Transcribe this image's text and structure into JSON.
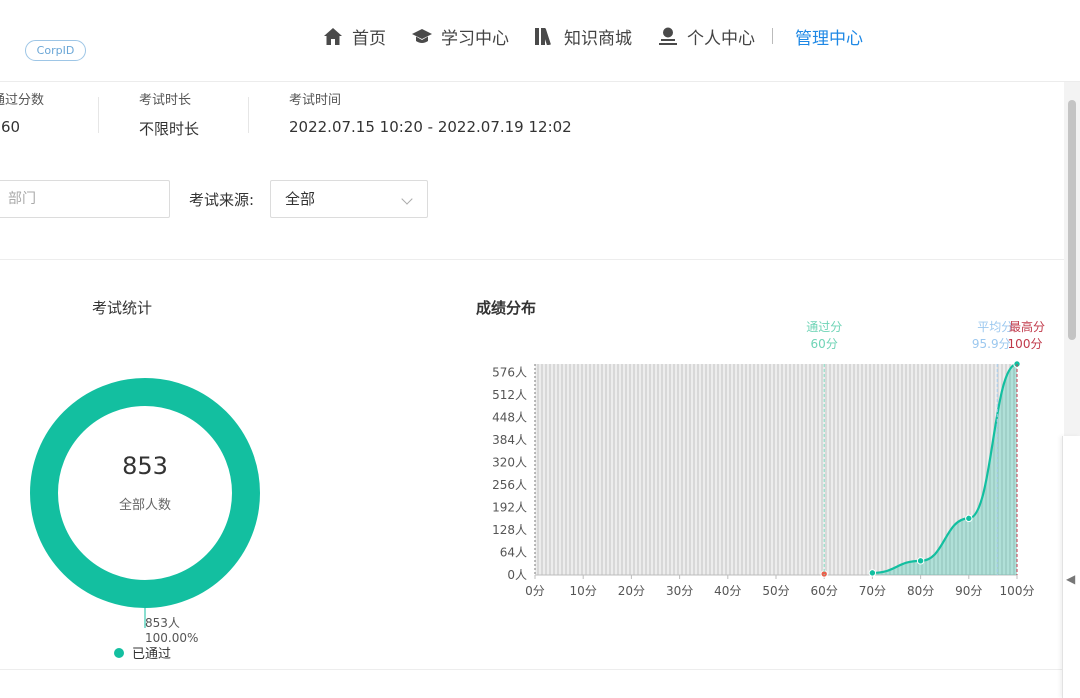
{
  "logo": "CorpID",
  "nav": {
    "items": [
      {
        "label": "首页",
        "icon": "home-icon"
      },
      {
        "label": "学习中心",
        "icon": "graduation-cap-icon"
      },
      {
        "label": "知识商城",
        "icon": "books-icon"
      },
      {
        "label": "个人中心",
        "icon": "user-icon"
      }
    ],
    "active": "管理中心"
  },
  "info": {
    "pass_label": "通过分数",
    "pass_value": "60",
    "duration_label": "考试时长",
    "duration_value": "不限时长",
    "time_label": "考试时间",
    "time_value": "2022.07.15 10:20 - 2022.07.19 12:02"
  },
  "filters": {
    "dept_placeholder": "部门",
    "source_label": "考试来源:",
    "source_value": "全部"
  },
  "stats": {
    "title": "考试统计",
    "total": "853",
    "total_label": "全部人数",
    "passed_count": "853人",
    "passed_pct": "100.00%",
    "legend_passed": "已通过"
  },
  "colors": {
    "accent": "#13bfa0",
    "nav_active": "#1e88e5",
    "pass_line": "#7fdcc0",
    "avg_line": "#a6cdf0",
    "max_line": "#c0394a",
    "point_red": "#e8604c"
  },
  "chart_data": {
    "type": "area",
    "title": "成绩分布",
    "x_ticks": [
      "0分",
      "10分",
      "20分",
      "30分",
      "40分",
      "50分",
      "60分",
      "70分",
      "80分",
      "90分",
      "100分"
    ],
    "y_ticks": [
      "0人",
      "64人",
      "128人",
      "192人",
      "256人",
      "320人",
      "384人",
      "448人",
      "512人",
      "576人"
    ],
    "xlim": [
      0,
      100
    ],
    "ylim": [
      0,
      596
    ],
    "points": [
      {
        "x": 60,
        "y": 3
      },
      {
        "x": 70,
        "y": 6
      },
      {
        "x": 80,
        "y": 40
      },
      {
        "x": 90,
        "y": 160
      },
      {
        "x": 100,
        "y": 596
      }
    ],
    "mark_lines": [
      {
        "label": "通过分",
        "value_label": "60分",
        "x": 60
      },
      {
        "label": "平均分",
        "value_label": "95.9分",
        "x": 95.9
      },
      {
        "label": "最高分",
        "value_label": "100分",
        "x": 100
      }
    ]
  }
}
